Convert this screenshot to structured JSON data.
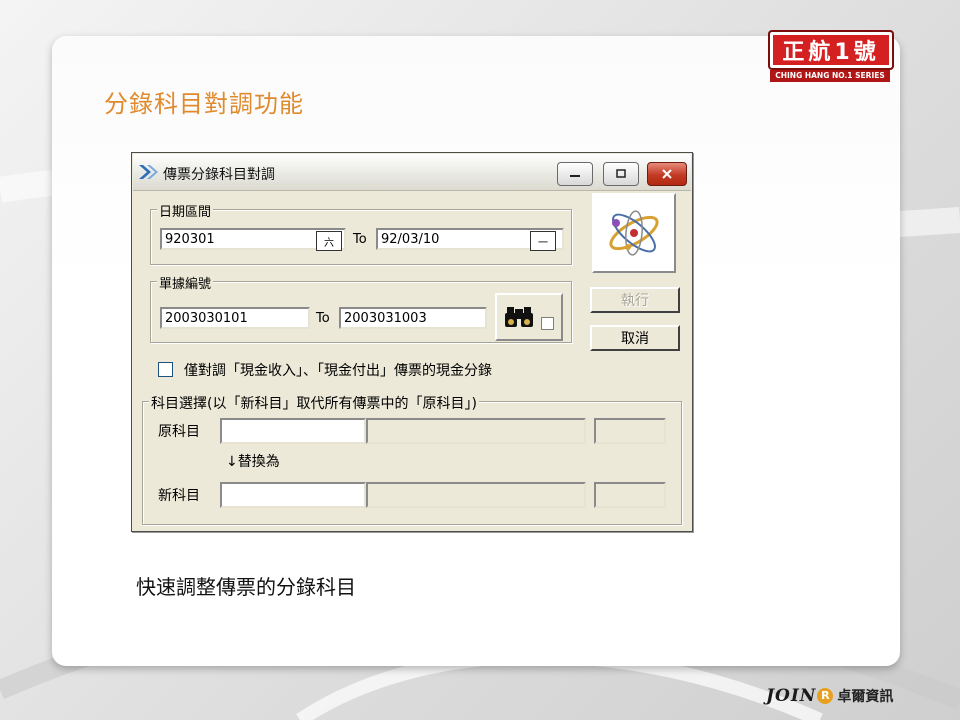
{
  "slide": {
    "title": "分錄科目對調功能",
    "caption": "快速調整傳票的分錄科目",
    "brand": {
      "main_text": "正航1號",
      "sub_text": "CHING HANG NO.1 SERIES"
    },
    "footer_logo": {
      "latin": "JOIN",
      "r_mark": "R",
      "chinese": "卓爾資訊"
    }
  },
  "dialog": {
    "title": "傳票分錄科目對調",
    "date_range": {
      "label": "日期區間",
      "from_value": "920301",
      "to_label": "To",
      "to_value": "92/03/10",
      "from_picker_glyph": "六",
      "to_picker_glyph": "一"
    },
    "voucher_range": {
      "label": "單據編號",
      "from_value": "2003030101",
      "to_label": "To",
      "to_value": "2003031003"
    },
    "cash_only_checkbox_label": "僅對調「現金收入」、「現金付出」傳票的現金分錄",
    "account_group": {
      "label": "科目選擇(以「新科目」取代所有傳票中的「原科目」)",
      "original_label": "原科目",
      "replace_hint": "↓替換為",
      "new_label": "新科目",
      "original_code": "",
      "original_name": "",
      "original_extra": "",
      "new_code": "",
      "new_name": "",
      "new_extra": ""
    },
    "execute_label": "執行",
    "cancel_label": "取消"
  },
  "colors": {
    "title_orange": "#e08a2e",
    "dialog_bg": "#ece9d8",
    "close_button_red": "#c33a23",
    "brand_red": "#d42020"
  }
}
